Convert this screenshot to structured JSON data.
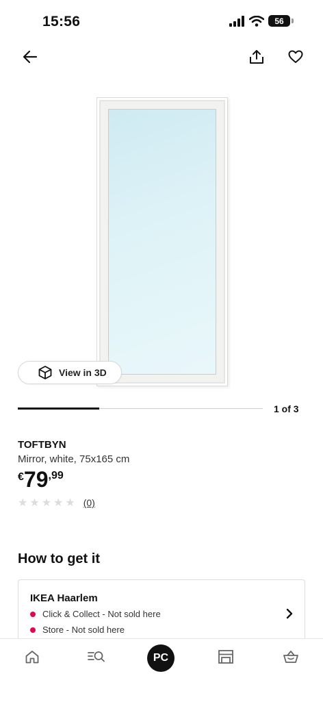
{
  "status_bar": {
    "time": "15:56",
    "battery": "56"
  },
  "topbar": {
    "back_icon": "arrow-left-icon",
    "share_icon": "share-icon",
    "favorite_icon": "heart-icon"
  },
  "gallery": {
    "view3d_label": "View in 3D",
    "pager": "1 of 3",
    "progress": 0.333
  },
  "product": {
    "name": "TOFTBYN",
    "description": "Mirror, white, 75x165 cm",
    "price_currency": "€",
    "price_int": "79",
    "price_dec": ",99",
    "rating_count": "(0)"
  },
  "availability": {
    "heading": "How to get it",
    "store": "IKEA Haarlem",
    "lines": [
      "Click & Collect - Not sold here",
      "Store - Not sold here"
    ],
    "status_color": "#e00751"
  },
  "bottom_nav": {
    "items": [
      "home-icon",
      "search-icon",
      "profile-avatar",
      "store-icon",
      "basket-icon"
    ],
    "profile_initials": "PC"
  }
}
